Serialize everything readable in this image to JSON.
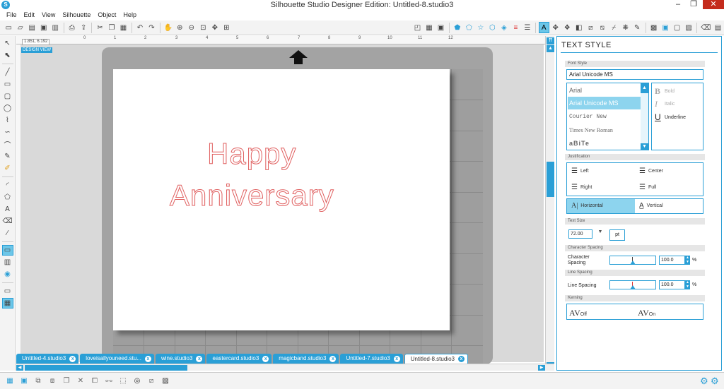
{
  "window": {
    "title": "Silhouette Studio Designer Edition: Untitled-8.studio3",
    "minimize": "–",
    "maximize": "❐",
    "close": "✕"
  },
  "menu": [
    "File",
    "Edit",
    "View",
    "Silhouette",
    "Object",
    "Help"
  ],
  "toolbar_left": [
    "new-file-icon",
    "open-file-icon",
    "library-icon",
    "save-icon",
    "save-as-icon",
    "print-icon",
    "send-icon",
    "cut-icon",
    "copy-icon",
    "paste-icon",
    "undo-icon",
    "redo-icon",
    "pan-icon",
    "zoom-in-icon",
    "zoom-out-icon",
    "zoom-box-icon",
    "drag-zoom-icon",
    "fit-page-icon"
  ],
  "toolbar_right": [
    "page-settings-icon",
    "grid-icon",
    "shape-fill-icon",
    "line-color-icon",
    "star-icon",
    "gradient-icon",
    "point-edit-icon",
    "line-style-icon",
    "fill-pattern-icon",
    "text-style-icon",
    "transform-icon",
    "replicate-icon",
    "modify-icon",
    "offset-icon",
    "trace-icon",
    "store-icon",
    "library-panel-icon",
    "cut-settings-icon",
    "design-view-icon",
    "eraser-icon",
    "send-to-silhouette-icon"
  ],
  "canvas": {
    "coords": "1.851, 6.192",
    "design_view": "DESIGN VIEW",
    "text_line1": "Happy",
    "text_line2": "Anniversary",
    "text_color": "#e06060"
  },
  "ruler_numbers": [
    "0",
    "1",
    "2",
    "3",
    "4",
    "5",
    "6",
    "7",
    "8",
    "9",
    "10",
    "11",
    "12"
  ],
  "tabs": [
    {
      "label": "Untitled-4.studio3",
      "close": "x"
    },
    {
      "label": "loveisallyouneed.stu...",
      "close": "x"
    },
    {
      "label": "wine.studio3",
      "close": "x"
    },
    {
      "label": "eastercard.studio3",
      "close": "x"
    },
    {
      "label": "magicband.studio3",
      "close": "x"
    },
    {
      "label": "Untitled-7.studio3",
      "close": "x"
    },
    {
      "label": "Untitled-8.studio3",
      "close": "x",
      "active": true
    }
  ],
  "panel": {
    "title": "TEXT STYLE",
    "font_style_label": "Font Style",
    "font_input": "Arial Unicode MS",
    "fonts": [
      "Arial",
      "Arial Unicode MS",
      "Courier New",
      "Times New Roman",
      "aBiTe"
    ],
    "selected_font": "Arial Unicode MS",
    "styles": {
      "bold": "Bold",
      "italic": "Italic",
      "underline": "Underline"
    },
    "justification_label": "Justification",
    "just": {
      "left": "Left",
      "center": "Center",
      "right": "Right",
      "full": "Full"
    },
    "orientation": {
      "horizontal": "Horizontal",
      "vertical": "Vertical",
      "selected": "Horizontal"
    },
    "text_size_label": "Text Size",
    "text_size": "72.00",
    "unit": "pt",
    "char_spacing_label": "Character Spacing",
    "char_spacing_field": "Character Spacing",
    "char_spacing": "100.0",
    "line_spacing_label": "Line Spacing",
    "line_spacing_field": "Line Spacing",
    "line_spacing": "100.0",
    "percent": "%",
    "kerning_label": "Kerning",
    "kerning_off": "Off",
    "kerning_on": "On",
    "kerning_glyph": "AV"
  },
  "accent": "#2a9fd6"
}
